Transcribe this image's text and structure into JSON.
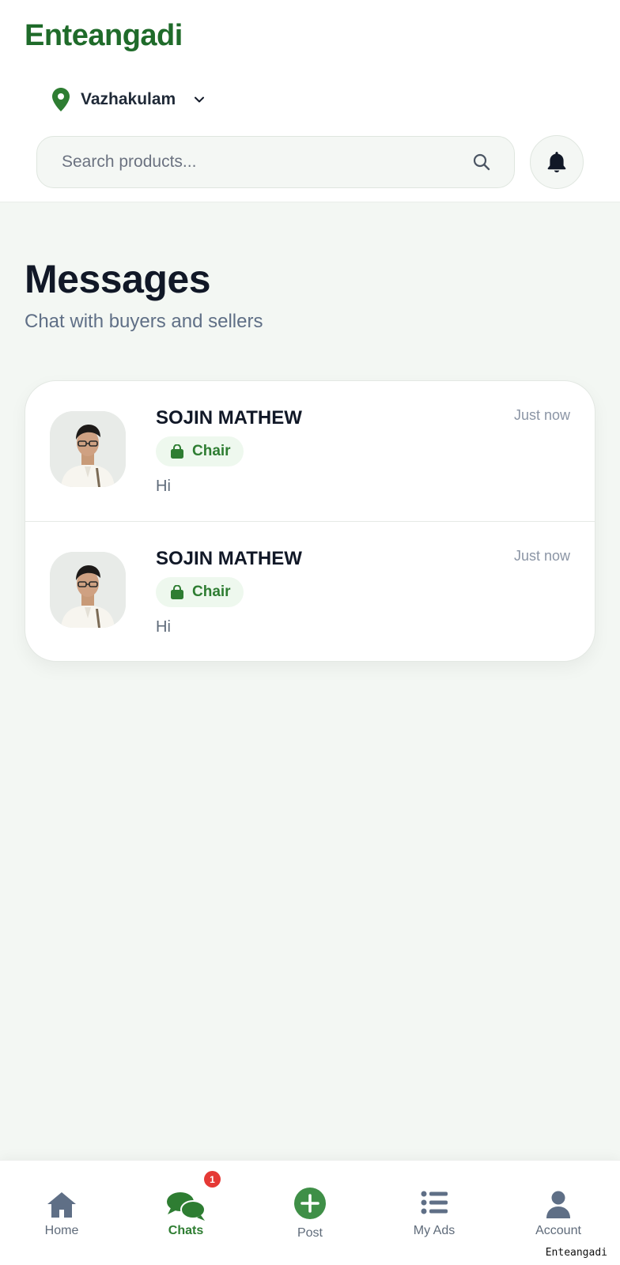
{
  "header": {
    "brand": "Enteangadi",
    "location": "Vazhakulam",
    "search_placeholder": "Search products..."
  },
  "page": {
    "title": "Messages",
    "subtitle": "Chat with buyers and sellers"
  },
  "conversations": [
    {
      "name": "SOJIN MATHEW",
      "product": "Chair",
      "preview": "Hi",
      "time": "Just now"
    },
    {
      "name": "SOJIN MATHEW",
      "product": "Chair",
      "preview": "Hi",
      "time": "Just now"
    }
  ],
  "bottom_nav": {
    "items": [
      {
        "label": "Home",
        "icon": "home-icon"
      },
      {
        "label": "Chats",
        "icon": "chat-icon",
        "badge": "1",
        "active": true
      },
      {
        "label": "Post",
        "icon": "plus-circle-icon"
      },
      {
        "label": "My Ads",
        "icon": "list-icon"
      },
      {
        "label": "Account",
        "icon": "user-icon"
      }
    ]
  },
  "watermark": "Enteangadi",
  "colors": {
    "brand": "#1f6b2a",
    "accent": "#2e7d32",
    "badge": "#e53935",
    "background": "#f3f7f3"
  }
}
